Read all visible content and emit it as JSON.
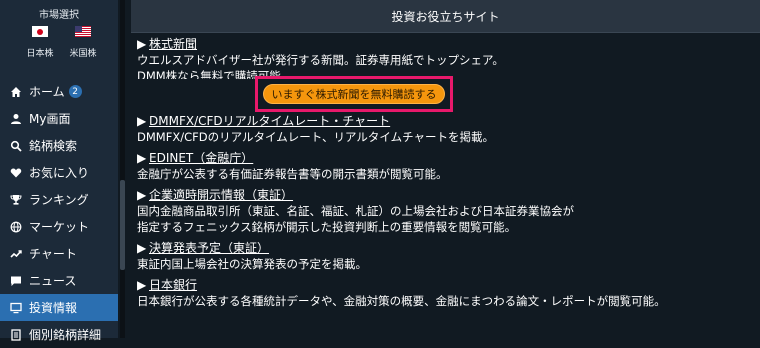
{
  "sidebar": {
    "market_title": "市場選択",
    "markets": [
      {
        "label": "日本株"
      },
      {
        "label": "米国株"
      }
    ],
    "items": [
      {
        "label": "ホーム",
        "badge": "2",
        "icon": "home-icon"
      },
      {
        "label": "My画面",
        "icon": "user-icon"
      },
      {
        "label": "銘柄検索",
        "icon": "search-icon"
      },
      {
        "label": "お気に入り",
        "icon": "heart-icon"
      },
      {
        "label": "ランキング",
        "icon": "trophy-icon"
      },
      {
        "label": "マーケット",
        "icon": "globe-icon"
      },
      {
        "label": "チャート",
        "icon": "trend-icon"
      },
      {
        "label": "ニュース",
        "icon": "chat-icon"
      },
      {
        "label": "投資情報",
        "icon": "monitor-icon",
        "active": true
      },
      {
        "label": "個別銘柄詳細",
        "icon": "document-icon"
      }
    ]
  },
  "header": {
    "title": "投資お役立ちサイト"
  },
  "entries": [
    {
      "arrow": "▶",
      "title": "株式新聞",
      "desc": [
        "ウエルスアドバイザー社が発行する新聞。証券専用紙でトップシェア。",
        "DMM株なら無料で購読可能。"
      ]
    },
    {
      "arrow": "▶",
      "title": "DMMFX/CFDリアルタイムレート・チャート",
      "desc": [
        "DMMFX/CFDのリアルタイムレート、リアルタイムチャートを掲載。"
      ]
    },
    {
      "arrow": "▶",
      "title": "EDINET（金融庁）",
      "desc": [
        "金融庁が公表する有価証券報告書等の開示書類が閲覧可能。"
      ]
    },
    {
      "arrow": "▶",
      "title": "企業適時開示情報（東証）",
      "desc": [
        "国内金融商品取引所（東証、名証、福証、札証）の上場会社および日本証券業協会が",
        "指定するフェニックス銘柄が開示した投資判断上の重要情報を閲覧可能。"
      ]
    },
    {
      "arrow": "▶",
      "title": "決算発表予定（東証）",
      "desc": [
        "東証内国上場会社の決算発表の予定を掲載。"
      ]
    },
    {
      "arrow": "▶",
      "title": "日本銀行",
      "desc": [
        "日本銀行が公表する各種統計データや、金融対策の概要、金融にまつわる論文・レポートが閲覧可能。"
      ]
    }
  ],
  "subscribe": {
    "label": "いますぐ株式新聞を無料購読する"
  },
  "colors": {
    "accent": "#2b6fb1",
    "button": "#f5960d",
    "highlight": "#e8196b"
  }
}
